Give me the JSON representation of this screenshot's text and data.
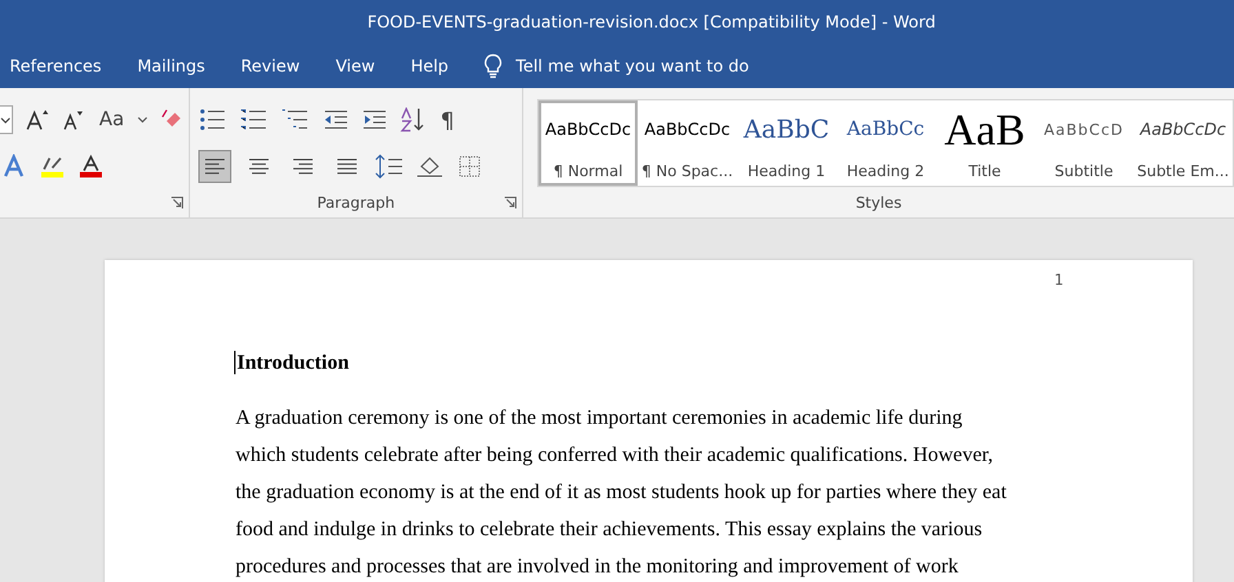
{
  "window": {
    "title": "FOOD-EVENTS-graduation-revision.docx [Compatibility Mode]  -  Word"
  },
  "tabs": [
    {
      "label": "References",
      "selected": false
    },
    {
      "label": "Mailings",
      "selected": false
    },
    {
      "label": "Review",
      "selected": false
    },
    {
      "label": "View",
      "selected": false
    },
    {
      "label": "Help",
      "selected": false
    }
  ],
  "tell_me": {
    "placeholder": "Tell me what you want to do"
  },
  "font_group": {
    "case_button": "Aa"
  },
  "paragraph_group": {
    "label": "Paragraph",
    "pilcrow": "¶",
    "alignment": [
      {
        "kind": "left",
        "selected": true
      },
      {
        "kind": "center",
        "selected": false
      },
      {
        "kind": "right",
        "selected": false
      },
      {
        "kind": "justify",
        "selected": false
      }
    ]
  },
  "styles_group": {
    "label": "Styles",
    "styles": [
      {
        "kind": "normal",
        "preview": "AaBbCcDc",
        "label": "¶ Normal",
        "selected": true
      },
      {
        "kind": "normal",
        "preview": "AaBbCcDc",
        "label": "¶ No Spac...",
        "selected": false
      },
      {
        "kind": "heading1",
        "preview": "AaBbC",
        "label": "Heading 1",
        "selected": false
      },
      {
        "kind": "heading2",
        "preview": "AaBbCc",
        "label": "Heading 2",
        "selected": false
      },
      {
        "kind": "title",
        "preview": "AaB",
        "label": "Title",
        "selected": false
      },
      {
        "kind": "subtitle",
        "preview": "AaBbCcD",
        "label": "Subtitle",
        "selected": false
      },
      {
        "kind": "emphasis",
        "preview": "AaBbCcDc",
        "label": "Subtle Em...",
        "selected": false
      }
    ]
  },
  "document": {
    "page_number": "1",
    "heading": "Introduction",
    "paragraph_lines": [
      "A graduation ceremony is one of the most important ceremonies in academic life during",
      "which students celebrate after being conferred with their academic qualifications. However,",
      "the graduation economy is at the end of it as most students hook up for parties where they eat",
      "food and indulge in drinks to celebrate their achievements. This essay explains the various",
      "procedures and processes that are involved in the monitoring and improvement of work"
    ]
  }
}
